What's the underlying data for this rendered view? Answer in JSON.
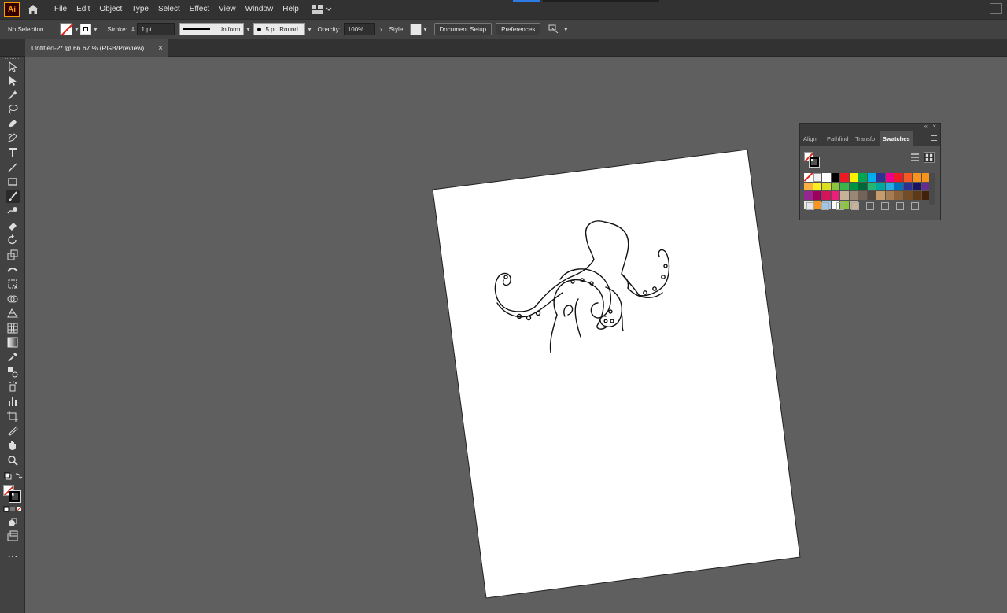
{
  "app": {
    "logo_text": "Ai",
    "menus": [
      "File",
      "Edit",
      "Object",
      "Type",
      "Select",
      "Effect",
      "View",
      "Window",
      "Help"
    ]
  },
  "control_bar": {
    "selection_status": "No Selection",
    "stroke_label": "Stroke:",
    "stroke_weight": "1 pt",
    "profile": "Uniform",
    "brush": "5 pt. Round",
    "opacity_label": "Opacity:",
    "opacity_value": "100%",
    "style_label": "Style:",
    "document_setup": "Document Setup",
    "preferences": "Preferences"
  },
  "document": {
    "tab_title": "Untitled-2* @ 66.67 % (RGB/Preview)",
    "tab_close": "×"
  },
  "toolbar": {
    "tools": [
      "selection",
      "direct-selection",
      "magic-wand",
      "lasso",
      "pen",
      "curvature",
      "type",
      "line-segment",
      "rectangle",
      "paintbrush",
      "shaper",
      "eraser",
      "rotate",
      "scale",
      "width",
      "free-transform",
      "shape-builder",
      "perspective-grid",
      "mesh",
      "gradient",
      "eyedropper",
      "blend",
      "symbol-sprayer",
      "column-graph",
      "artboard",
      "slice",
      "hand",
      "zoom"
    ],
    "active_tool": "paintbrush",
    "more_tools": "..."
  },
  "swatches_panel": {
    "tabs": [
      "Align",
      "Pathfinder",
      "Transform",
      "Swatches"
    ],
    "tab_display": [
      "Align",
      "Pathfind",
      "Transfo",
      "Swatches"
    ],
    "active_tab": "Swatches",
    "swatch_colors": [
      "#ffffff",
      "#ffffff",
      "#ffffff",
      "#000000",
      "#ed1c24",
      "#fff200",
      "#00a651",
      "#00aeef",
      "#2e3192",
      "#ec008c",
      "#ed1c24",
      "#f15a24",
      "#f7931e",
      "#f7941d",
      "#fbb040",
      "#fcee21",
      "#d9e021",
      "#8cc63f",
      "#39b54a",
      "#009245",
      "#006837",
      "#22b573",
      "#00a99d",
      "#29abe2",
      "#0071bc",
      "#2e3192",
      "#1b1464",
      "#662d91",
      "#93278f",
      "#9e005d",
      "#d4145a",
      "#ed1e79",
      "#c7b299",
      "#998675",
      "#736357",
      "#534741",
      "#c69c6d",
      "#a67c52",
      "#8c6239",
      "#754c24",
      "#603813",
      "#42210b",
      "#e6e6e6",
      "#f7931e",
      "#9fc5e8",
      "#ffffff",
      "#8cc63f",
      "#c7b299"
    ]
  }
}
